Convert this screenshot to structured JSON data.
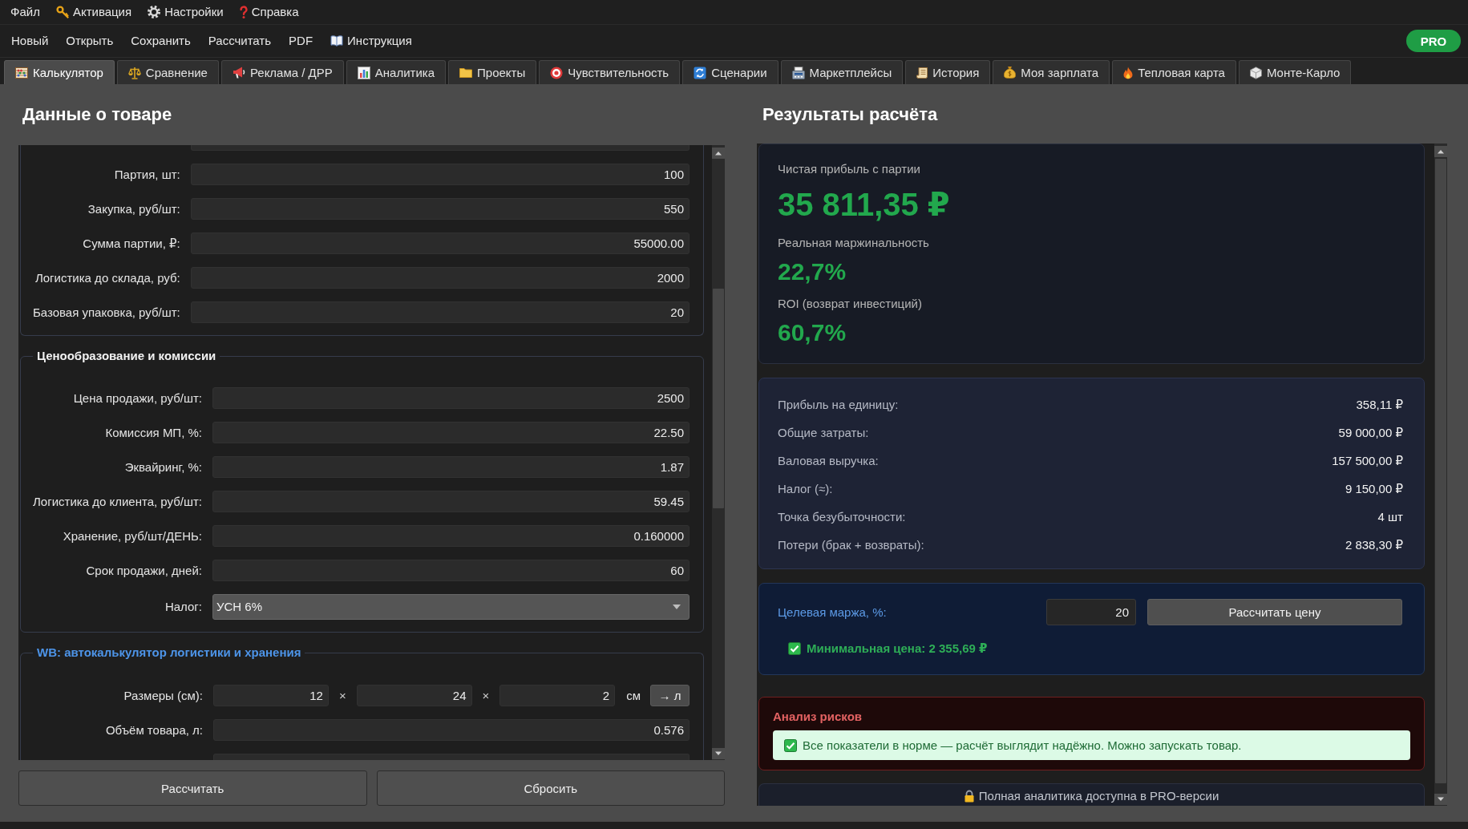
{
  "menu_bar": [
    "Файл",
    "Активация",
    "Настройки",
    "Справка"
  ],
  "toolbar": {
    "buttons": [
      "Новый",
      "Открыть",
      "Сохранить",
      "Рассчитать",
      "PDF",
      "Инструкция"
    ],
    "badge": "PRO"
  },
  "tabs": [
    {
      "label": "Калькулятор",
      "selected": true
    },
    {
      "label": "Сравнение",
      "selected": false
    },
    {
      "label": "Реклама / ДРР",
      "selected": false
    },
    {
      "label": "Аналитика",
      "selected": false
    },
    {
      "label": "Проекты",
      "selected": false
    },
    {
      "label": "Чувствительность",
      "selected": false
    },
    {
      "label": "Сценарии",
      "selected": false
    },
    {
      "label": "Маркетплейсы",
      "selected": false
    },
    {
      "label": "История",
      "selected": false
    },
    {
      "label": "Моя зарплата",
      "selected": false
    },
    {
      "label": "Тепловая карта",
      "selected": false
    },
    {
      "label": "Монте-Карло",
      "selected": false
    }
  ],
  "product_panel": {
    "title": "Данные о товаре",
    "groups": [
      {
        "fields": [
          {
            "kind": "clipped"
          },
          {
            "kind": "number",
            "label": "Партия, шт:",
            "value": "100"
          },
          {
            "kind": "number",
            "label": "Закупка, руб/шт:",
            "value": "550"
          },
          {
            "kind": "number",
            "label": "Сумма партии, ₽:",
            "value": "55000.00"
          },
          {
            "kind": "number",
            "label": "Логистика до склада, руб:",
            "value": "2000"
          },
          {
            "kind": "number",
            "label": "Базовая упаковка, руб/шт:",
            "value": "20"
          }
        ]
      },
      {
        "title": "Ценообразование и комиссии",
        "accent": false,
        "fields": [
          {
            "kind": "number",
            "label": "Цена продажи, руб/шт:",
            "value": "2500"
          },
          {
            "kind": "number",
            "label": "Комиссия МП, %:",
            "value": "22.50"
          },
          {
            "kind": "number",
            "label": "Эквайринг, %:",
            "value": "1.87"
          },
          {
            "kind": "number",
            "label": "Логистика до клиента, руб/шт:",
            "value": "59.45"
          },
          {
            "kind": "number",
            "label": "Хранение, руб/шт/ДЕНЬ:",
            "value": "0.160000"
          },
          {
            "kind": "number",
            "label": "Срок продажи, дней:",
            "value": "60"
          },
          {
            "kind": "select",
            "label": "Налог:",
            "value": "УСН 6%"
          }
        ]
      },
      {
        "title": "WB: автокалькулятор логистики и хранения",
        "accent": true,
        "fields": [
          {
            "kind": "dimensions",
            "label": "Размеры (см):",
            "values": [
              "12",
              "24",
              "2"
            ],
            "separators": [
              "×",
              "×"
            ],
            "unit": "см",
            "button": "→ л"
          },
          {
            "kind": "number",
            "label": "Объём товара, л:",
            "value": "0.576"
          },
          {
            "kind": "clipped"
          }
        ]
      }
    ],
    "buttons": [
      "Рассчитать",
      "Сбросить"
    ]
  },
  "results_panel": {
    "title": "Результаты расчёта",
    "summary": [
      {
        "kind": "primary",
        "label": "Чистая прибыль с партии",
        "value": "35 811,35 ₽"
      },
      {
        "kind": "secondary",
        "label": "Реальная маржинальность",
        "value": "22,7%"
      },
      {
        "kind": "secondary",
        "label": "ROI (возврат инвестиций)",
        "value": "60,7%"
      }
    ],
    "details": [
      {
        "label": "Прибыль на единицу:",
        "value": "358,11 ₽"
      },
      {
        "label": "Общие затраты:",
        "value": "59 000,00 ₽"
      },
      {
        "label": "Валовая выручка:",
        "value": "157 500,00 ₽"
      },
      {
        "label": "Налог (≈):",
        "value": "9 150,00 ₽"
      },
      {
        "label": "Точка безубыточности:",
        "value": "4 шт"
      },
      {
        "label": "Потери (брак + возвраты):",
        "value": "2 838,30 ₽"
      }
    ],
    "target": {
      "label": "Целевая маржа, %:",
      "value": "20",
      "button": "Рассчитать цену",
      "result": {
        "kind": "ok",
        "text": "Минимальная цена: 2 355,69 ₽"
      }
    },
    "risks": {
      "title": "Анализ рисков",
      "messages": [
        {
          "kind": "ok",
          "text": "Все показатели в норме — расчёт выглядит надёжно. Можно запускать товар."
        }
      ]
    },
    "pro_notice": "Полная аналитика доступна в PRO-версии"
  }
}
